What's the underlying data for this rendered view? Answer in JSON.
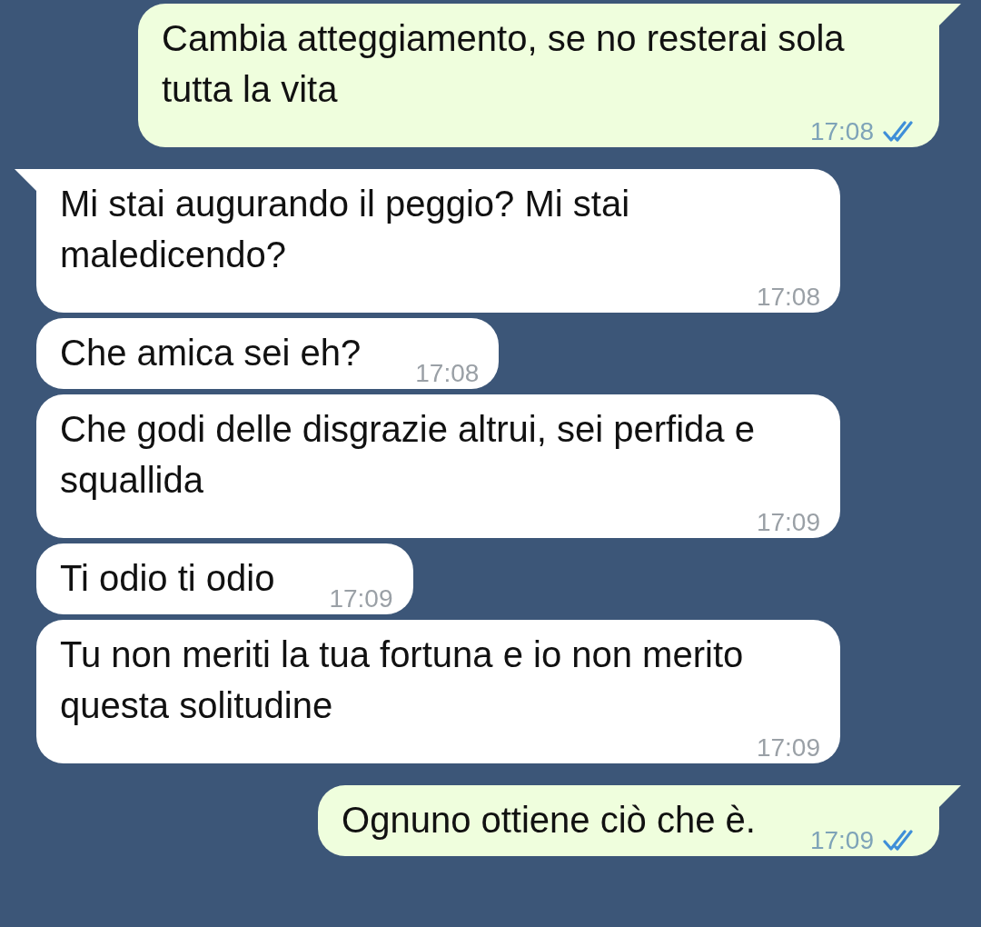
{
  "messages": [
    {
      "kind": "outgoing",
      "tail": true,
      "text": "Cambia atteggiamento, se no resterai sola tutta la vita",
      "time": "17:08",
      "read": true
    },
    {
      "kind": "incoming",
      "tail": true,
      "text": "Mi stai augurando il peggio? Mi stai maledicendo?",
      "time": "17:08"
    },
    {
      "kind": "incoming",
      "tail": false,
      "text": "Che amica sei eh?",
      "time": "17:08"
    },
    {
      "kind": "incoming",
      "tail": false,
      "text": "Che godi delle disgrazie altrui, sei perfida e squallida",
      "time": "17:09"
    },
    {
      "kind": "incoming",
      "tail": false,
      "text": "Ti odio ti odio",
      "time": "17:09"
    },
    {
      "kind": "incoming",
      "tail": false,
      "text": "Tu non meriti la tua fortuna e io non merito questa solitudine",
      "time": "17:09"
    },
    {
      "kind": "outgoing",
      "tail": true,
      "text": "Ognuno ottiene ciò che è.",
      "time": "17:09",
      "read": true
    }
  ]
}
